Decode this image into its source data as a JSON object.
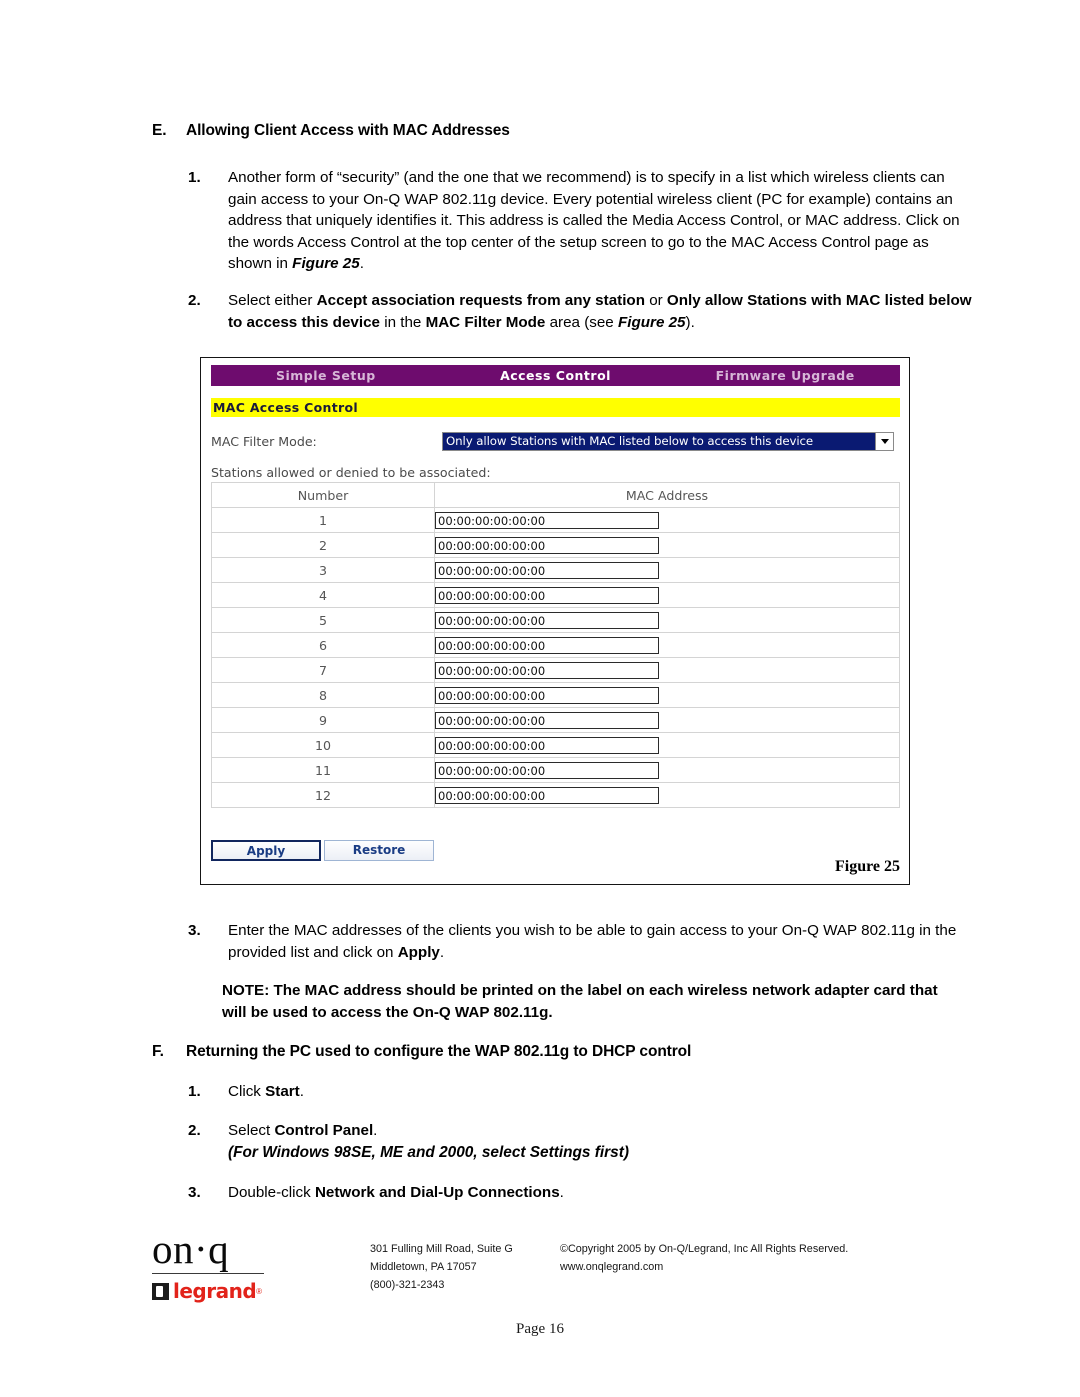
{
  "document": {
    "page_label": "Page 16"
  },
  "sections": {
    "e": {
      "letter": "E.",
      "title": "Allowing Client Access with MAC Addresses",
      "items": [
        {
          "num": "1.",
          "parts": [
            {
              "t": "Another form of “security” (and the one that we recommend) is to specify in a list which wireless clients can gain access to your On-Q WAP 802.11g device. Every potential wireless client (PC for example) contains an address that uniquely identifies it. This address is called the Media Access Control, or MAC address. Click on the words Access Control at the top center of the setup screen to go to the MAC Access Control page as shown in ",
              "s": "n"
            },
            {
              "t": "Figure 25",
              "s": "bi"
            },
            {
              "t": ".",
              "s": "n"
            }
          ]
        },
        {
          "num": "2.",
          "parts": [
            {
              "t": "Select either ",
              "s": "n"
            },
            {
              "t": "Accept association requests from any station",
              "s": "b"
            },
            {
              "t": " or ",
              "s": "n"
            },
            {
              "t": "Only allow Stations with MAC listed below to access this device",
              "s": "b"
            },
            {
              "t": " in the ",
              "s": "n"
            },
            {
              "t": "MAC Filter Mode",
              "s": "b"
            },
            {
              "t": " area (see ",
              "s": "n"
            },
            {
              "t": "Figure 25",
              "s": "bi"
            },
            {
              "t": ").",
              "s": "n"
            }
          ]
        },
        {
          "num": "3.",
          "parts": [
            {
              "t": "Enter the MAC addresses of the clients you wish to be able to gain access to your On-Q WAP 802.11g in the provided list and click on ",
              "s": "n"
            },
            {
              "t": "Apply",
              "s": "b"
            },
            {
              "t": ".",
              "s": "n"
            }
          ]
        }
      ],
      "note": "NOTE: The MAC address should be printed on the label on each wireless network adapter card that will be used to access the On-Q WAP 802.11g."
    },
    "f": {
      "letter": "F.",
      "title": "Returning the PC used to configure the WAP 802.11g to DHCP control",
      "items": [
        {
          "num": "1.",
          "parts": [
            {
              "t": "Click ",
              "s": "n"
            },
            {
              "t": "Start",
              "s": "b"
            },
            {
              "t": ".",
              "s": "n"
            }
          ]
        },
        {
          "num": "2.",
          "parts": [
            {
              "t": "Select ",
              "s": "n"
            },
            {
              "t": "Control Panel",
              "s": "b"
            },
            {
              "t": ".",
              "s": "n"
            }
          ],
          "subline": "(For Windows 98SE, ME and 2000, select Settings first)"
        },
        {
          "num": "3.",
          "parts": [
            {
              "t": "Double-click ",
              "s": "n"
            },
            {
              "t": "Network and Dial-Up Connections",
              "s": "b"
            },
            {
              "t": ".",
              "s": "n"
            }
          ]
        }
      ]
    }
  },
  "figure": {
    "caption": "Figure 25",
    "nav": {
      "items": [
        {
          "label": "Simple Setup",
          "active": false
        },
        {
          "label": "Access Control",
          "active": true
        },
        {
          "label": "Firmware Upgrade",
          "active": false
        }
      ]
    },
    "title_bar": "MAC Access Control",
    "filter": {
      "label": "MAC Filter Mode:",
      "selected": "Only allow Stations with MAC listed below to access this device",
      "options": [
        "Accept association requests from any station",
        "Only allow Stations with MAC listed below to access this device"
      ]
    },
    "table": {
      "intro": "Stations allowed or denied to be associated:",
      "headers": [
        "Number",
        "MAC Address"
      ],
      "rows": [
        {
          "number": "1",
          "mac": "00:00:00:00:00:00"
        },
        {
          "number": "2",
          "mac": "00:00:00:00:00:00"
        },
        {
          "number": "3",
          "mac": "00:00:00:00:00:00"
        },
        {
          "number": "4",
          "mac": "00:00:00:00:00:00"
        },
        {
          "number": "5",
          "mac": "00:00:00:00:00:00"
        },
        {
          "number": "6",
          "mac": "00:00:00:00:00:00"
        },
        {
          "number": "7",
          "mac": "00:00:00:00:00:00"
        },
        {
          "number": "8",
          "mac": "00:00:00:00:00:00"
        },
        {
          "number": "9",
          "mac": "00:00:00:00:00:00"
        },
        {
          "number": "10",
          "mac": "00:00:00:00:00:00"
        },
        {
          "number": "11",
          "mac": "00:00:00:00:00:00"
        },
        {
          "number": "12",
          "mac": "00:00:00:00:00:00"
        }
      ]
    },
    "buttons": {
      "apply": "Apply",
      "restore": "Restore"
    },
    "colors": {
      "nav_bar": "#6E0C6E",
      "title_bar": "#FFFF00",
      "select_highlight": "#0A1A72",
      "button_text": "#1A3C84"
    }
  },
  "footer": {
    "logo": {
      "brand": "on·q",
      "partner": "legrand"
    },
    "address": [
      "301 Fulling Mill Road, Suite G",
      "Middletown, PA   17057",
      "(800)-321-2343"
    ],
    "copyright": [
      "©Copyright 2005 by On-Q/Legrand, Inc All Rights Reserved.",
      "www.onqlegrand.com"
    ]
  }
}
